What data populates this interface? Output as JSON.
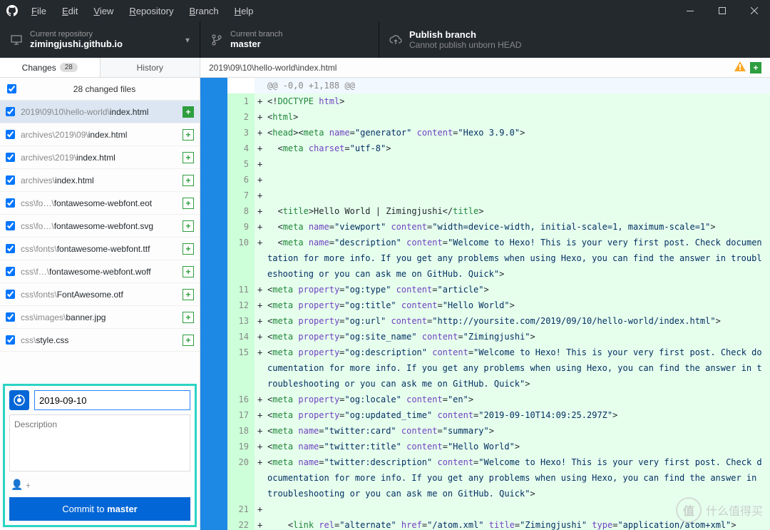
{
  "menu": [
    "File",
    "Edit",
    "View",
    "Repository",
    "Branch",
    "Help"
  ],
  "repo": {
    "label": "Current repository",
    "value": "zimingjushi.github.io"
  },
  "branch": {
    "label": "Current branch",
    "value": "master"
  },
  "publish": {
    "label": "Publish branch",
    "sub": "Cannot publish unborn HEAD"
  },
  "tabs": {
    "changes": "Changes",
    "changes_count": "28",
    "history": "History"
  },
  "changes_header": "28 changed files",
  "files": [
    {
      "dir": "2019\\09\\10\\hello-world\\",
      "name": "index.html",
      "status": "solid",
      "selected": true
    },
    {
      "dir": "archives\\2019\\09\\",
      "name": "index.html",
      "status": "plus"
    },
    {
      "dir": "archives\\2019\\",
      "name": "index.html",
      "status": "plus"
    },
    {
      "dir": "archives\\",
      "name": "index.html",
      "status": "plus"
    },
    {
      "dir": "css\\fo…\\",
      "name": "fontawesome-webfont.eot",
      "status": "plus"
    },
    {
      "dir": "css\\fo…\\",
      "name": "fontawesome-webfont.svg",
      "status": "plus"
    },
    {
      "dir": "css\\fonts\\",
      "name": "fontawesome-webfont.ttf",
      "status": "plus"
    },
    {
      "dir": "css\\f…\\",
      "name": "fontawesome-webfont.woff",
      "status": "plus"
    },
    {
      "dir": "css\\fonts\\",
      "name": "FontAwesome.otf",
      "status": "plus"
    },
    {
      "dir": "css\\images\\",
      "name": "banner.jpg",
      "status": "plus"
    },
    {
      "dir": "css\\",
      "name": "style.css",
      "status": "plus"
    }
  ],
  "commit": {
    "summary": "2019-09-10",
    "desc_placeholder": "Description",
    "button_pre": "Commit to ",
    "button_branch": "master"
  },
  "diff_path": "2019\\09\\10\\hello-world\\index.html",
  "hunk": "@@ -0,0 +1,188 @@",
  "code": [
    {
      "n": 1,
      "html": "<span class='pl'>&lt;!</span><span class='tag'>DOCTYPE</span> <span class='attr'>html</span><span class='pl'>&gt;</span>"
    },
    {
      "n": 2,
      "html": "<span class='pl'>&lt;</span><span class='tag'>html</span><span class='pl'>&gt;</span>"
    },
    {
      "n": 3,
      "html": "<span class='pl'>&lt;</span><span class='tag'>head</span><span class='pl'>&gt;&lt;</span><span class='tag'>meta</span> <span class='attr'>name</span>=<span class='str'>\"generator\"</span> <span class='attr'>content</span>=<span class='str'>\"Hexo 3.9.0\"</span><span class='pl'>&gt;</span>"
    },
    {
      "n": 4,
      "html": "  <span class='pl'>&lt;</span><span class='tag'>meta</span> <span class='attr'>charset</span>=<span class='str'>\"utf-8\"</span><span class='pl'>&gt;</span>"
    },
    {
      "n": 5,
      "html": "  "
    },
    {
      "n": 6,
      "html": ""
    },
    {
      "n": 7,
      "html": ""
    },
    {
      "n": 8,
      "html": "  <span class='pl'>&lt;</span><span class='tag'>title</span><span class='pl'>&gt;</span>Hello World | Zimingjushi<span class='pl'>&lt;/</span><span class='tag'>title</span><span class='pl'>&gt;</span>"
    },
    {
      "n": 9,
      "html": "  <span class='pl'>&lt;</span><span class='tag'>meta</span> <span class='attr'>name</span>=<span class='str'>\"viewport\"</span> <span class='attr'>content</span>=<span class='str'>\"width=device-width, initial-scale=1, maximum-scale=1\"</span><span class='pl'>&gt;</span>"
    },
    {
      "n": 10,
      "html": "  <span class='pl'>&lt;</span><span class='tag'>meta</span> <span class='attr'>name</span>=<span class='str'>\"description\"</span> <span class='attr'>content</span>=<span class='str'>\"Welcome to Hexo! This is your very first post. Check documentation for more info. If you get any problems when using Hexo, you can find the answer in troubleshooting or you can ask me on GitHub. Quick\"</span><span class='pl'>&gt;</span>"
    },
    {
      "n": 11,
      "html": "<span class='pl'>&lt;</span><span class='tag'>meta</span> <span class='attr'>property</span>=<span class='str'>\"og:type\"</span> <span class='attr'>content</span>=<span class='str'>\"article\"</span><span class='pl'>&gt;</span>"
    },
    {
      "n": 12,
      "html": "<span class='pl'>&lt;</span><span class='tag'>meta</span> <span class='attr'>property</span>=<span class='str'>\"og:title\"</span> <span class='attr'>content</span>=<span class='str'>\"Hello World\"</span><span class='pl'>&gt;</span>"
    },
    {
      "n": 13,
      "html": "<span class='pl'>&lt;</span><span class='tag'>meta</span> <span class='attr'>property</span>=<span class='str'>\"og:url\"</span> <span class='attr'>content</span>=<span class='str'>\"http://yoursite.com/2019/09/10/hello-world/index.html\"</span><span class='pl'>&gt;</span>"
    },
    {
      "n": 14,
      "html": "<span class='pl'>&lt;</span><span class='tag'>meta</span> <span class='attr'>property</span>=<span class='str'>\"og:site_name\"</span> <span class='attr'>content</span>=<span class='str'>\"Zimingjushi\"</span><span class='pl'>&gt;</span>"
    },
    {
      "n": 15,
      "html": "<span class='pl'>&lt;</span><span class='tag'>meta</span> <span class='attr'>property</span>=<span class='str'>\"og:description\"</span> <span class='attr'>content</span>=<span class='str'>\"Welcome to Hexo! This is your very first post. Check documentation for more info. If you get any problems when using Hexo, you can find the answer in troubleshooting or you can ask me on GitHub. Quick\"</span><span class='pl'>&gt;</span>"
    },
    {
      "n": 16,
      "html": "<span class='pl'>&lt;</span><span class='tag'>meta</span> <span class='attr'>property</span>=<span class='str'>\"og:locale\"</span> <span class='attr'>content</span>=<span class='str'>\"en\"</span><span class='pl'>&gt;</span>"
    },
    {
      "n": 17,
      "html": "<span class='pl'>&lt;</span><span class='tag'>meta</span> <span class='attr'>property</span>=<span class='str'>\"og:updated_time\"</span> <span class='attr'>content</span>=<span class='str'>\"2019-09-10T14:09:25.297Z\"</span><span class='pl'>&gt;</span>"
    },
    {
      "n": 18,
      "html": "<span class='pl'>&lt;</span><span class='tag'>meta</span> <span class='attr'>name</span>=<span class='str'>\"twitter:card\"</span> <span class='attr'>content</span>=<span class='str'>\"summary\"</span><span class='pl'>&gt;</span>"
    },
    {
      "n": 19,
      "html": "<span class='pl'>&lt;</span><span class='tag'>meta</span> <span class='attr'>name</span>=<span class='str'>\"twitter:title\"</span> <span class='attr'>content</span>=<span class='str'>\"Hello World\"</span><span class='pl'>&gt;</span>"
    },
    {
      "n": 20,
      "html": "<span class='pl'>&lt;</span><span class='tag'>meta</span> <span class='attr'>name</span>=<span class='str'>\"twitter:description\"</span> <span class='attr'>content</span>=<span class='str'>\"Welcome to Hexo! This is your very first post. Check documentation for more info. If you get any problems when using Hexo, you can find the answer in troubleshooting or you can ask me on GitHub. Quick\"</span><span class='pl'>&gt;</span>"
    },
    {
      "n": 21,
      "html": ""
    },
    {
      "n": 22,
      "html": "    <span class='pl'>&lt;</span><span class='tag'>link</span> <span class='attr'>rel</span>=<span class='str'>\"alternate\"</span> <span class='attr'>href</span>=<span class='str'>\"/atom.xml\"</span> <span class='attr'>title</span>=<span class='str'>\"Zimingjushi\"</span> <span class='attr'>type</span>=<span class='str'>\"application/atom+xml\"</span><span class='pl'>&gt;</span>"
    }
  ],
  "watermark": {
    "icon": "值",
    "text": "什么值得买"
  }
}
